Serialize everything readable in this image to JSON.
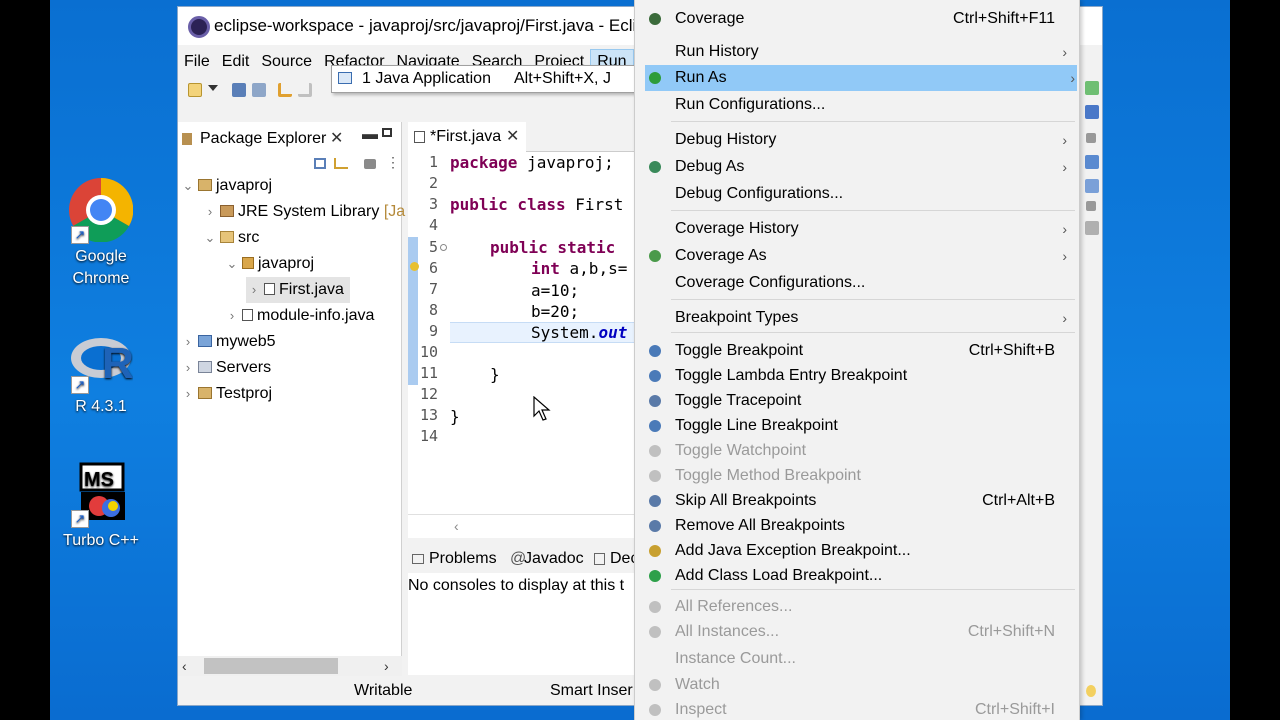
{
  "desktop": {
    "icons": [
      {
        "label": "Google Chrome"
      },
      {
        "label": "R 4.3.1"
      },
      {
        "label": "Turbo C++"
      }
    ],
    "r_glyph": "R",
    "ms_logo_text": "MS"
  },
  "window": {
    "title": "eclipse-workspace - javaproj/src/javaproj/First.java - Eclips",
    "menubar": [
      "File",
      "Edit",
      "Source",
      "Refactor",
      "Navigate",
      "Search",
      "Project",
      "Run"
    ]
  },
  "run_popup": {
    "item": "1 Java Application",
    "shortcut": "Alt+Shift+X, J"
  },
  "package_explorer": {
    "title": "Package Explorer",
    "tree": [
      {
        "label": "javaproj",
        "expander": "⌄"
      },
      {
        "label": "JRE System Library",
        "suffix": "[Ja",
        "expander": "›"
      },
      {
        "label": "src",
        "expander": "⌄"
      },
      {
        "label": "javaproj",
        "expander": "⌄"
      },
      {
        "label": "First.java",
        "expander": "›"
      },
      {
        "label": "module-info.java",
        "expander": "›"
      },
      {
        "label": "myweb5",
        "expander": "›"
      },
      {
        "label": "Servers",
        "expander": "›"
      },
      {
        "label": "Testproj",
        "expander": "›"
      }
    ]
  },
  "editor": {
    "tab": "*First.java",
    "line_numbers": [
      "1",
      "2",
      "3",
      "4",
      "5",
      "6",
      "7",
      "8",
      "9",
      "10",
      "11",
      "12",
      "13",
      "14"
    ],
    "code": {
      "l1_kw": "package",
      "l1_rest": " javaproj;",
      "l3_kw": "public class",
      "l3_rest": " First",
      "l5_kw": "public static",
      "l5_rest": "",
      "l6_kw": "int",
      "l6_rest": " a,b,s=",
      "l7": "a=10;",
      "l8": "b=20;",
      "l9_pre": "System.",
      "l9_italic": "out",
      "l11": "}",
      "l13": "}"
    }
  },
  "bottom_panel": {
    "tabs": [
      "Problems",
      "Javadoc",
      "Dec"
    ],
    "message": "No consoles to display at this t"
  },
  "status": {
    "left": "Writable",
    "right": "Smart Inser"
  },
  "menu": {
    "items": [
      {
        "label": "Coverage",
        "shortcut": "Ctrl+Shift+F11",
        "sub": "",
        "disabled": false
      },
      {
        "label": "Run History",
        "shortcut": "",
        "sub": "›",
        "disabled": false
      },
      {
        "label": "Run As",
        "shortcut": "",
        "sub": "›",
        "disabled": false,
        "selected": true
      },
      {
        "label": "Run Configurations...",
        "shortcut": "",
        "sub": "",
        "disabled": false
      },
      {
        "label": "Debug History",
        "shortcut": "",
        "sub": "›",
        "disabled": false
      },
      {
        "label": "Debug As",
        "shortcut": "",
        "sub": "›",
        "disabled": false
      },
      {
        "label": "Debug Configurations...",
        "shortcut": "",
        "sub": "",
        "disabled": false
      },
      {
        "label": "Coverage History",
        "shortcut": "",
        "sub": "›",
        "disabled": false
      },
      {
        "label": "Coverage As",
        "shortcut": "",
        "sub": "›",
        "disabled": false
      },
      {
        "label": "Coverage Configurations...",
        "shortcut": "",
        "sub": "",
        "disabled": false
      },
      {
        "label": "Breakpoint Types",
        "shortcut": "",
        "sub": "›",
        "disabled": false
      },
      {
        "label": "Toggle Breakpoint",
        "shortcut": "Ctrl+Shift+B",
        "sub": "",
        "disabled": false
      },
      {
        "label": "Toggle Lambda Entry Breakpoint",
        "shortcut": "",
        "sub": "",
        "disabled": false
      },
      {
        "label": "Toggle Tracepoint",
        "shortcut": "",
        "sub": "",
        "disabled": false
      },
      {
        "label": "Toggle Line Breakpoint",
        "shortcut": "",
        "sub": "",
        "disabled": false
      },
      {
        "label": "Toggle Watchpoint",
        "shortcut": "",
        "sub": "",
        "disabled": true
      },
      {
        "label": "Toggle Method Breakpoint",
        "shortcut": "",
        "sub": "",
        "disabled": true
      },
      {
        "label": "Skip All Breakpoints",
        "shortcut": "Ctrl+Alt+B",
        "sub": "",
        "disabled": false
      },
      {
        "label": "Remove All Breakpoints",
        "shortcut": "",
        "sub": "",
        "disabled": false
      },
      {
        "label": "Add Java Exception Breakpoint...",
        "shortcut": "",
        "sub": "",
        "disabled": false
      },
      {
        "label": "Add Class Load Breakpoint...",
        "shortcut": "",
        "sub": "",
        "disabled": false
      },
      {
        "label": "All References...",
        "shortcut": "",
        "sub": "",
        "disabled": true
      },
      {
        "label": "All Instances...",
        "shortcut": "Ctrl+Shift+N",
        "sub": "",
        "disabled": true
      },
      {
        "label": "Instance Count...",
        "shortcut": "",
        "sub": "",
        "disabled": true
      },
      {
        "label": "Watch",
        "shortcut": "",
        "sub": "",
        "disabled": true
      },
      {
        "label": "Inspect",
        "shortcut": "Ctrl+Shift+I",
        "sub": "",
        "disabled": true
      }
    ]
  },
  "colors": {
    "desktop": "#0f7fe0",
    "menu_selection": "#91c9f7",
    "keyword": "#7f0055"
  }
}
